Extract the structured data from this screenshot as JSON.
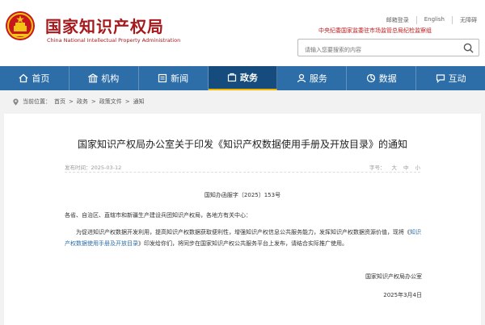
{
  "brand": {
    "name_cn": "国家知识产权局",
    "name_en": "China National Intellectual Property Administration"
  },
  "top_links": [
    "邮箱登录",
    "English",
    "无障碍"
  ],
  "notice": "中央纪委国家监委驻市场监管总局纪检监察组",
  "search": {
    "placeholder": "请输入您要搜索的内容"
  },
  "nav": {
    "items": [
      {
        "label": "首页",
        "icon": "home-icon"
      },
      {
        "label": "机构",
        "icon": "building-icon"
      },
      {
        "label": "新闻",
        "icon": "news-icon"
      },
      {
        "label": "政务",
        "icon": "gov-affairs-icon",
        "active": true
      },
      {
        "label": "服务",
        "icon": "service-icon"
      },
      {
        "label": "数据",
        "icon": "data-icon"
      },
      {
        "label": "互动",
        "icon": "interaction-icon"
      }
    ]
  },
  "breadcrumb": {
    "prefix": "当前位置：",
    "path": [
      "首页",
      "政务",
      "政策文件",
      "通知"
    ],
    "separator": ">"
  },
  "article": {
    "title": "国家知识产权局办公室关于印发《知识产权数据使用手册及开放目录》的通知",
    "publish_label": "发布时间：",
    "publish_date": "2025-03-12",
    "font_size_label": "字号：",
    "font_sizes": [
      "大",
      "中",
      "小"
    ],
    "doc_number": "国知办函服字〔2025〕153号",
    "recipients": "各省、自治区、直辖市和新疆生产建设兵团知识产权局，各地方有关中心：",
    "body_before_link": "为促进知识产权数据开发利用，提高知识产权数据获取便利性，增强知识产权信息公共服务能力，发挥知识产权数据资源价值，现将《",
    "body_link": "知识产权数据使用手册及开放目录",
    "body_after_link": "》印发给你们，将同步在国家知识产权公共服务平台上发布，请结合实际推广使用。",
    "signature_org": "国家知识产权局办公室",
    "signature_date": "2025年3月4日"
  },
  "colors": {
    "brand_red": "#a61a1d",
    "nav_blue": "#2d6ea8",
    "nav_active": "#154b7d",
    "notice_red": "#c1191b"
  }
}
